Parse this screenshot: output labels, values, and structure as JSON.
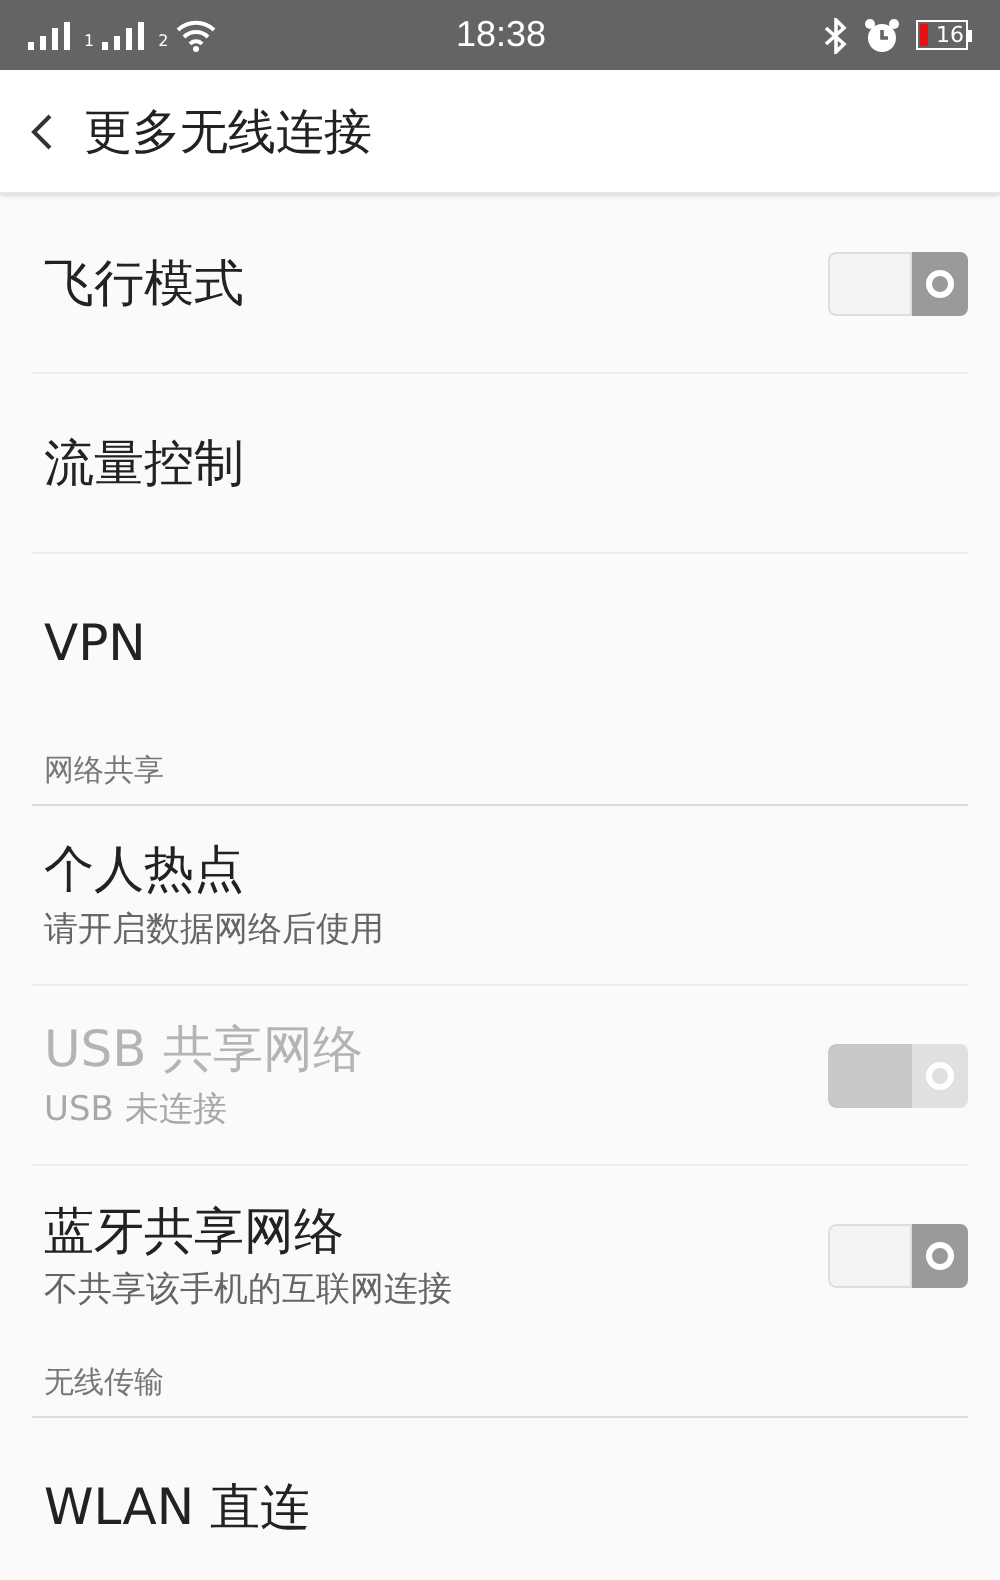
{
  "status_bar": {
    "sim_1": "1",
    "sim_2": "2",
    "time": "18:38",
    "battery": "16"
  },
  "header": {
    "title": "更多无线连接"
  },
  "sections": [
    {
      "items": [
        {
          "kind": "toggle",
          "title": "飞行模式",
          "disabled": false,
          "on": false
        },
        {
          "kind": "plain",
          "title": "流量控制",
          "disabled": false
        },
        {
          "kind": "plain",
          "title": "VPN",
          "disabled": false
        }
      ]
    },
    {
      "title": "网络共享",
      "items": [
        {
          "kind": "plain",
          "title": "个人热点",
          "subtitle": "请开启数据网络后使用",
          "disabled": false
        },
        {
          "kind": "toggle",
          "title": "USB 共享网络",
          "subtitle": "USB 未连接",
          "disabled": true,
          "on": false
        },
        {
          "kind": "toggle",
          "title": "蓝牙共享网络",
          "subtitle": "不共享该手机的互联网连接",
          "disabled": false,
          "on": false
        }
      ]
    },
    {
      "title": "无线传输",
      "items": [
        {
          "kind": "plain",
          "title": "WLAN 直连",
          "disabled": false
        }
      ]
    }
  ]
}
